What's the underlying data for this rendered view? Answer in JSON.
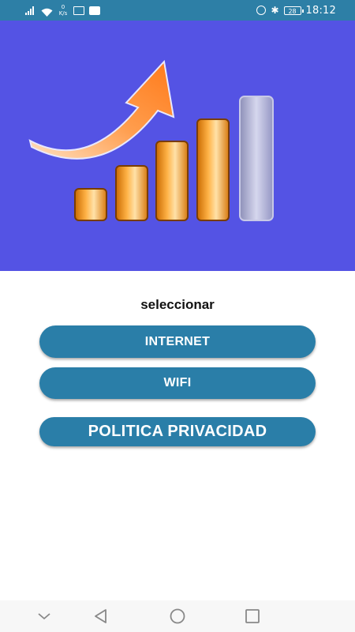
{
  "status_bar": {
    "net_speed_value": "0",
    "net_speed_unit": "K/s",
    "battery_level": "28",
    "time": "18:12",
    "icons": [
      "signal-icon",
      "wifi-icon",
      "screen-icon",
      "notification-icon",
      "alarm-icon",
      "bluetooth-icon",
      "battery-icon"
    ]
  },
  "banner": {
    "background_color": "#5453e4",
    "image": "growth-chart-arrow-illustration"
  },
  "main": {
    "prompt": "seleccionar",
    "buttons": [
      {
        "label": "INTERNET"
      },
      {
        "label": "WIFI"
      },
      {
        "label": "POLITICA PRIVACIDAD"
      }
    ],
    "button_color": "#2a7ea8"
  },
  "nav_bar": {
    "icons": [
      "chevron-down-icon",
      "back-icon",
      "home-icon",
      "recents-icon"
    ]
  }
}
